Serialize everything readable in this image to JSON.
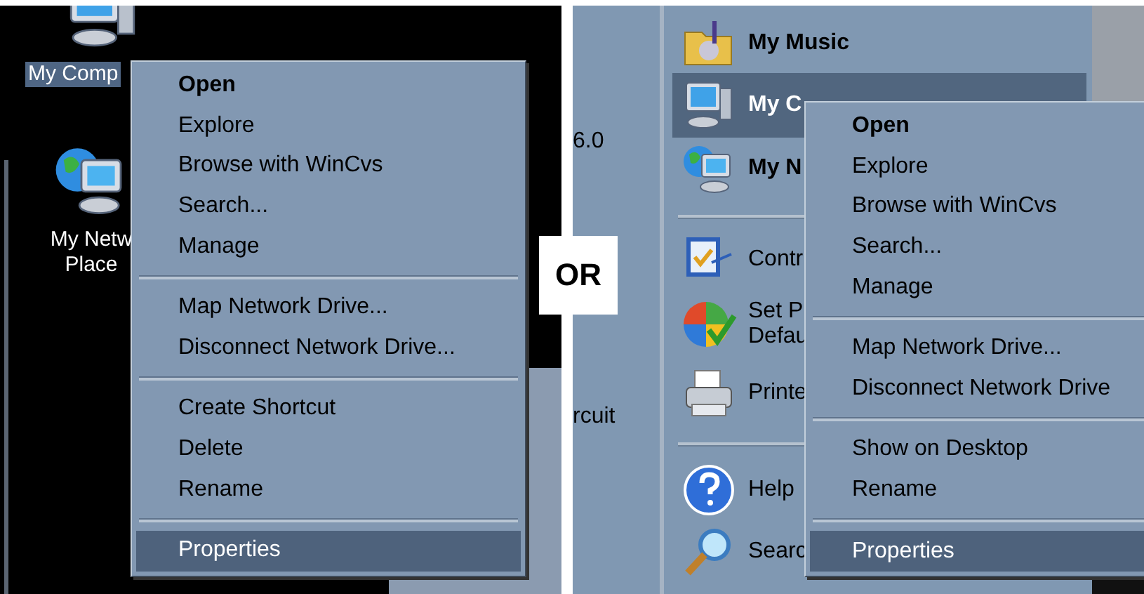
{
  "left_screenshot": {
    "desktop_icons": [
      {
        "kind": "computer",
        "label": "My Comp",
        "selected": true
      },
      {
        "kind": "network",
        "label": "My Netw\nPlace",
        "selected": false
      }
    ],
    "context_menu": {
      "items": [
        {
          "kind": "item",
          "label": "Open",
          "default": true,
          "selected": false
        },
        {
          "kind": "item",
          "label": "Explore",
          "default": false,
          "selected": false
        },
        {
          "kind": "item",
          "label": "Browse with WinCvs",
          "default": false,
          "selected": false
        },
        {
          "kind": "item",
          "label": "Search...",
          "default": false,
          "selected": false
        },
        {
          "kind": "item",
          "label": "Manage",
          "default": false,
          "selected": false
        },
        {
          "kind": "separator"
        },
        {
          "kind": "item",
          "label": "Map Network Drive...",
          "default": false,
          "selected": false
        },
        {
          "kind": "item",
          "label": "Disconnect Network Drive...",
          "default": false,
          "selected": false
        },
        {
          "kind": "separator"
        },
        {
          "kind": "item",
          "label": "Create Shortcut",
          "default": false,
          "selected": false
        },
        {
          "kind": "item",
          "label": "Delete",
          "default": false,
          "selected": false
        },
        {
          "kind": "item",
          "label": "Rename",
          "default": false,
          "selected": false
        },
        {
          "kind": "separator"
        },
        {
          "kind": "item",
          "label": "Properties",
          "default": false,
          "selected": true
        }
      ]
    }
  },
  "divider_label": "OR",
  "right_screenshot": {
    "background_texts": [
      "6.0",
      "rcuit"
    ],
    "start_menu": {
      "items": [
        {
          "kind": "item",
          "label": "My Music",
          "bold": true,
          "selected": false
        },
        {
          "kind": "item",
          "label": "My C",
          "bold": true,
          "selected": true
        },
        {
          "kind": "item",
          "label": "My N",
          "bold": true,
          "selected": false
        },
        {
          "kind": "separator"
        },
        {
          "kind": "item",
          "label": "Contr",
          "bold": false,
          "selected": false
        },
        {
          "kind": "item",
          "label": "Set P\nDefau",
          "bold": false,
          "selected": false
        },
        {
          "kind": "item",
          "label": "Printe",
          "bold": false,
          "selected": false
        },
        {
          "kind": "separator"
        },
        {
          "kind": "item",
          "label": "Help",
          "bold": false,
          "selected": false
        },
        {
          "kind": "item",
          "label": "Searc",
          "bold": false,
          "selected": false
        }
      ]
    },
    "context_menu": {
      "items": [
        {
          "kind": "item",
          "label": "Open",
          "default": true,
          "selected": false
        },
        {
          "kind": "item",
          "label": "Explore",
          "default": false,
          "selected": false
        },
        {
          "kind": "item",
          "label": "Browse with WinCvs",
          "default": false,
          "selected": false
        },
        {
          "kind": "item",
          "label": "Search...",
          "default": false,
          "selected": false
        },
        {
          "kind": "item",
          "label": "Manage",
          "default": false,
          "selected": false
        },
        {
          "kind": "separator"
        },
        {
          "kind": "item",
          "label": "Map Network Drive...",
          "default": false,
          "selected": false
        },
        {
          "kind": "item",
          "label": "Disconnect Network Drive",
          "default": false,
          "selected": false
        },
        {
          "kind": "separator"
        },
        {
          "kind": "item",
          "label": "Show on Desktop",
          "default": false,
          "selected": false
        },
        {
          "kind": "item",
          "label": "Rename",
          "default": false,
          "selected": false
        },
        {
          "kind": "separator"
        },
        {
          "kind": "item",
          "label": "Properties",
          "default": false,
          "selected": true
        }
      ]
    }
  }
}
